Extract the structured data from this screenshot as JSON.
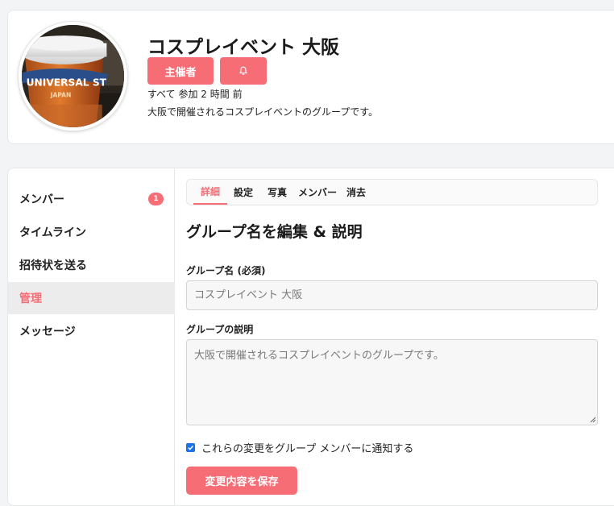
{
  "header": {
    "title": "コスプレイベント 大阪",
    "role_label": "主催者",
    "bell_icon": "bell-icon",
    "meta": "すべて 参加 2 時間 前",
    "description": "大阪で開催されるコスプレイベントのグループです。",
    "avatar_logo_text": "UNIVERSAL ST",
    "avatar_logo_sub": "JAPAN"
  },
  "sidebar": {
    "items": [
      {
        "label": "メンバー",
        "badge": "1",
        "active": false
      },
      {
        "label": "タイムライン",
        "active": false
      },
      {
        "label": "招待状を送る",
        "active": false
      },
      {
        "label": "管理",
        "active": true
      },
      {
        "label": "メッセージ",
        "active": false
      }
    ]
  },
  "tabs": [
    {
      "label": "詳細",
      "active": true
    },
    {
      "label": "設定",
      "active": false
    },
    {
      "label": "写真",
      "active": false
    },
    {
      "label": "メンバー",
      "active": false
    },
    {
      "label": "消去",
      "active": false
    }
  ],
  "form": {
    "title": "グループ名を編集 & 説明",
    "name_label": "グループ名 (必須)",
    "name_placeholder": "コスプレイベント 大阪",
    "desc_label": "グループの説明",
    "desc_placeholder": "大阪で開催されるコスプレイベントのグループです。",
    "notify_label": "これらの変更をグループ メンバーに通知する",
    "notify_checked": true,
    "save_label": "変更内容を保存"
  },
  "colors": {
    "accent": "#f66d76",
    "checkbox": "#1a73e8",
    "active_bg": "#ececec"
  }
}
